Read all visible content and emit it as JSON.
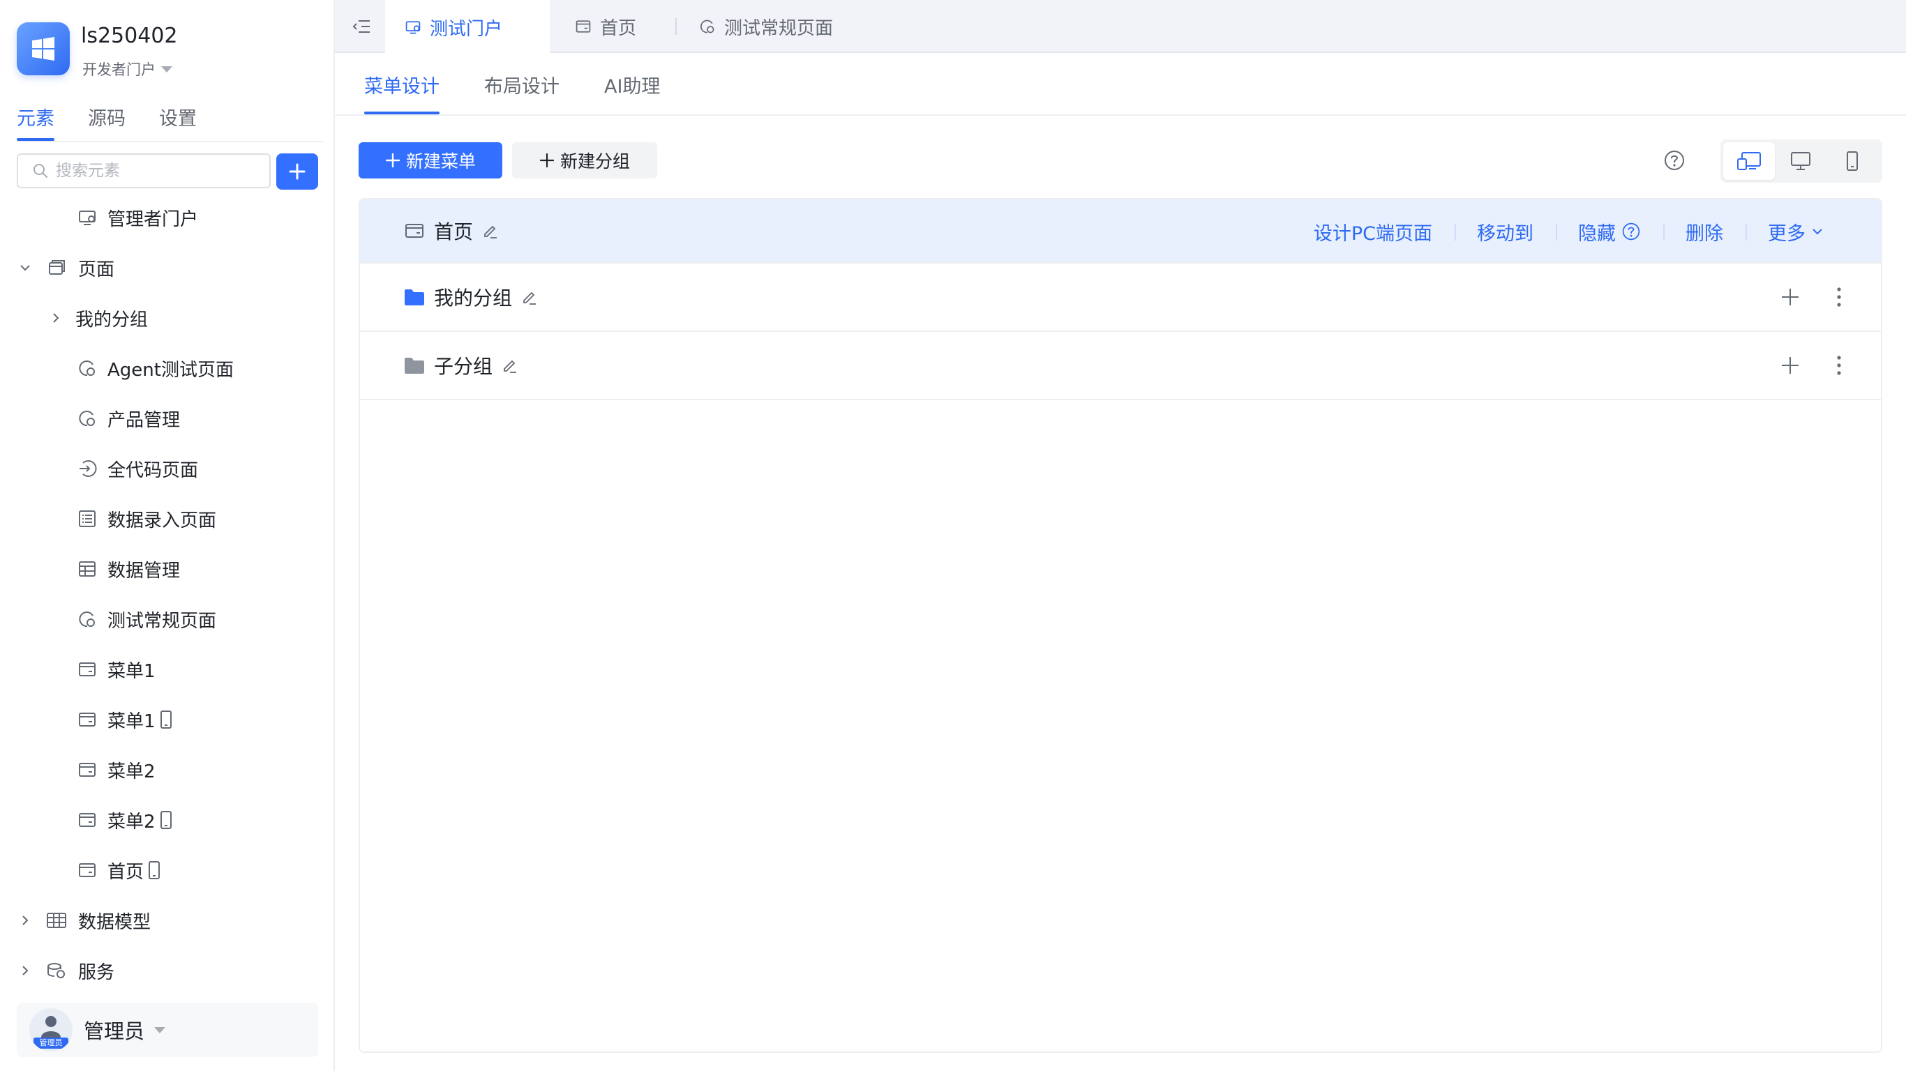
{
  "app": {
    "title": "ls250402",
    "portal_label": "开发者门户"
  },
  "sidebar": {
    "tabs": [
      {
        "label": "元素"
      },
      {
        "label": "源码"
      },
      {
        "label": "设置"
      }
    ],
    "search_placeholder": "搜索元素",
    "tree": [
      {
        "label": "管理者门户"
      },
      {
        "label": "页面"
      },
      {
        "label": "我的分组"
      },
      {
        "label": "Agent测试页面"
      },
      {
        "label": "产品管理"
      },
      {
        "label": "全代码页面"
      },
      {
        "label": "数据录入页面"
      },
      {
        "label": "数据管理"
      },
      {
        "label": "测试常规页面"
      },
      {
        "label": "菜单1"
      },
      {
        "label": "菜单1"
      },
      {
        "label": "菜单2"
      },
      {
        "label": "菜单2"
      },
      {
        "label": "首页"
      },
      {
        "label": "数据模型"
      },
      {
        "label": "服务"
      }
    ],
    "user": {
      "name": "管理员",
      "avatar_tag": "管理员"
    }
  },
  "window_tabs": [
    {
      "label": "测试门户"
    },
    {
      "label": "首页"
    },
    {
      "label": "测试常规页面"
    }
  ],
  "main": {
    "sub_tabs": [
      {
        "label": "菜单设计"
      },
      {
        "label": "布局设计"
      },
      {
        "label": "AI助理"
      }
    ],
    "toolbar": {
      "new_menu": "新建菜单",
      "new_group": "新建分组"
    },
    "rows": [
      {
        "label": "首页",
        "actions": [
          {
            "label": "设计PC端页面"
          },
          {
            "label": "移动到"
          },
          {
            "label": "隐藏"
          },
          {
            "label": "删除"
          },
          {
            "label": "更多"
          }
        ]
      },
      {
        "label": "我的分组"
      },
      {
        "label": "子分组"
      }
    ]
  },
  "colors": {
    "accent": "#3370ff",
    "highlight_row": "#e8effd",
    "folder_blue": "#3370ff",
    "folder_gray": "#8f959e"
  }
}
